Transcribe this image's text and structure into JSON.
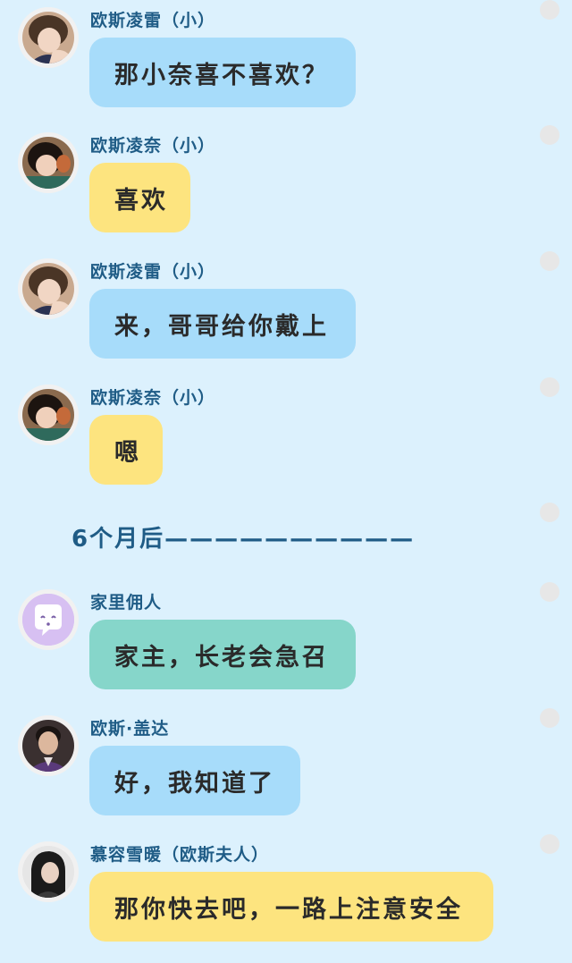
{
  "colors": {
    "background": "#dcf1fd",
    "bubble_blue": "#a7dcfa",
    "bubble_yellow": "#fde47f",
    "bubble_teal": "#86d6ca",
    "name_text": "#1f5c86",
    "bubble_text": "#2a2a2a"
  },
  "messages": [
    {
      "name": "欧斯凌雷（小）",
      "text": "那小奈喜不喜欢？",
      "avatar": "boy-photo-avatar",
      "bubble_color": "blue"
    },
    {
      "name": "欧斯凌奈（小）",
      "text": "喜欢",
      "avatar": "girl-photo-avatar",
      "bubble_color": "yellow"
    },
    {
      "name": "欧斯凌雷（小）",
      "text": "来，哥哥给你戴上",
      "avatar": "boy-photo-avatar",
      "bubble_color": "blue"
    },
    {
      "name": "欧斯凌奈（小）",
      "text": "嗯",
      "avatar": "girl-photo-avatar",
      "bubble_color": "yellow"
    },
    {
      "name": "家里佣人",
      "text": "家主，长老会急召",
      "avatar": "chat-bubble-icon",
      "bubble_color": "teal"
    },
    {
      "name": "欧斯·盖达",
      "text": "好，我知道了",
      "avatar": "man-photo-avatar",
      "bubble_color": "blue"
    },
    {
      "name": "慕容雪暖（欧斯夫人）",
      "text": "那你快去吧，一路上注意安全",
      "avatar": "woman-photo-avatar",
      "bubble_color": "yellow"
    }
  ],
  "divider": {
    "text": "6个月后——————————"
  }
}
